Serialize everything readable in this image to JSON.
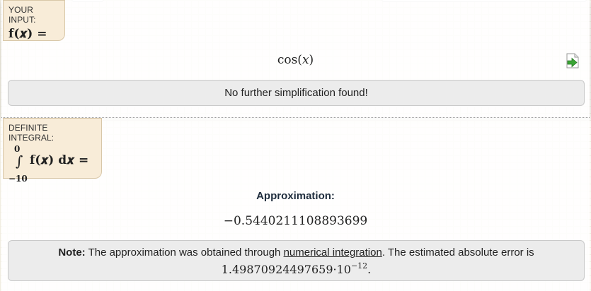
{
  "input_section": {
    "label": "YOUR INPUT:",
    "lhs": "f(𝒙) =",
    "expression": "cos(𝑥)",
    "simplification_message": "No further simplification found!"
  },
  "integral_section": {
    "label": "DEFINITE INTEGRAL:",
    "upper_limit": "0",
    "lower_limit": "−10",
    "integral_sign": "∫",
    "integrand": "f(𝒙) d𝒙 =",
    "approx_heading": "Approximation:",
    "approx_value": "−0.5440211108893699",
    "note": {
      "bold": "Note:",
      "text_before": "The approximation was obtained through",
      "link": "numerical integration",
      "text_after": ". The estimated absolute error is",
      "error_mantissa": "1.49870924497659·10",
      "error_exponent": "−12",
      "error_end": "."
    }
  },
  "icons": {
    "export": "export-arrow-icon"
  }
}
